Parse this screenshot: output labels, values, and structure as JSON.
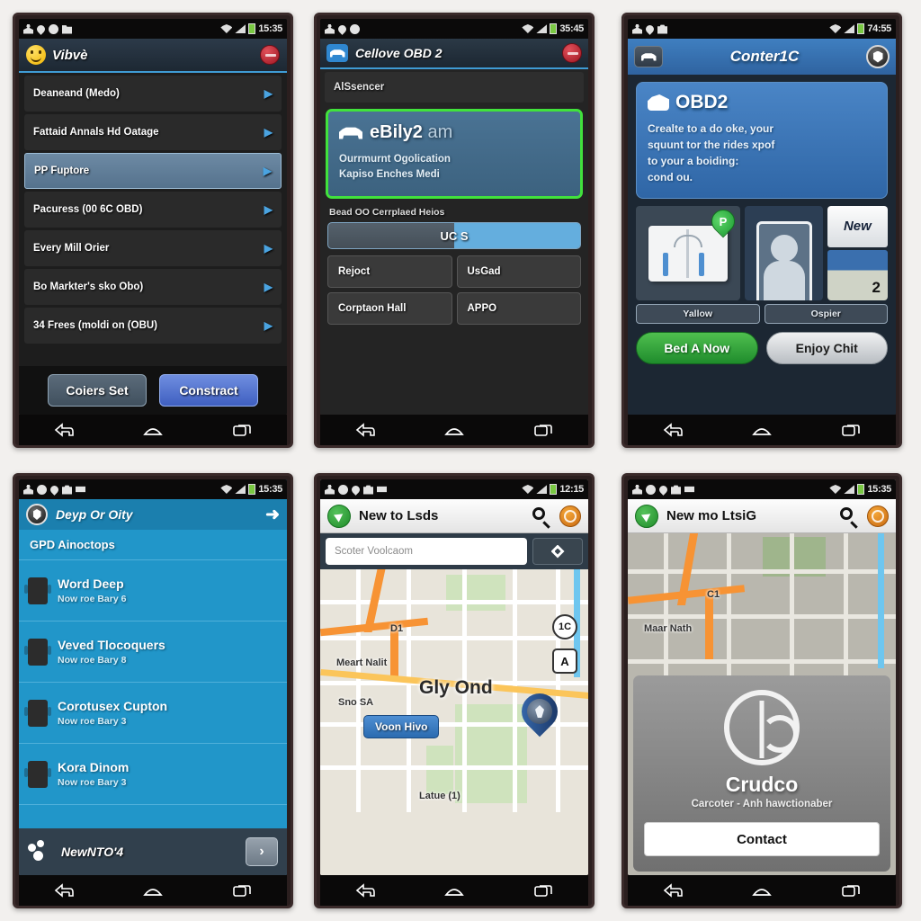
{
  "screens": [
    {
      "id": "vehicle-settings",
      "status": {
        "time": "15:35",
        "icons": [
          "person-icon",
          "pin-icon",
          "clock-icon",
          "folder-icon"
        ],
        "right_icons": [
          "wifi-icon",
          "signal-icon",
          "battery-icon"
        ]
      },
      "title": "Vibvè",
      "close_label": "close",
      "rows": [
        {
          "label": "Deaneand (Medo)",
          "selected": false
        },
        {
          "label": "Fattaid Annals Hd Oatage",
          "selected": false
        },
        {
          "label": "PP Fuptore",
          "selected": true
        },
        {
          "label": "Pacuress (00 6C OBD)",
          "selected": false
        },
        {
          "label": "Every Mill Orier",
          "selected": false
        },
        {
          "label": "Bo Markter's sko Obo)",
          "selected": false
        },
        {
          "label": "34 Frees (moldi on (OBU)",
          "selected": false
        }
      ],
      "buttons": {
        "secondary": "Coiers Set",
        "primary": "Constract"
      }
    },
    {
      "id": "obd-pair",
      "status": {
        "time": "35:45",
        "icons": [
          "person-icon",
          "pin-icon",
          "clock-icon"
        ],
        "right_icons": [
          "wifi-icon",
          "signal-icon",
          "battery-icon"
        ]
      },
      "title": "Cellove OBD 2",
      "subtitle": "AlSsencer",
      "card": {
        "title": "eBily2",
        "title_dim": "am",
        "line1": "Ourrmurnt Ogolication",
        "line2": "Kapiso Enches Medi"
      },
      "slider_label": "Bead OO Cerrplaed Heios",
      "slider_value": "UC S",
      "slider_fill_pct": 50,
      "grid_buttons": [
        "Rejoct",
        "UsGad",
        "Corptaon Hall",
        "APPO"
      ]
    },
    {
      "id": "obd-promo",
      "status": {
        "time": "74:55",
        "icons": [
          "person-icon",
          "pin-icon",
          "lock-icon"
        ],
        "right_icons": [
          "wifi-icon",
          "signal-icon",
          "battery-icon"
        ]
      },
      "title": "Conter1C",
      "hero": {
        "title": "OBD2",
        "lines": [
          "Crealte to a do oke, your",
          "squunt tor the rides xpof",
          "to your a boiding:",
          "cond ou."
        ]
      },
      "tiles": {
        "new_badge": "New",
        "map_badge": "2",
        "pin_letter": "P"
      },
      "tile_labels": [
        "Yallow",
        "Ospier"
      ],
      "cta": {
        "primary": "Bed A Now",
        "secondary": "Enjoy Chit"
      }
    },
    {
      "id": "device-list",
      "status": {
        "time": "15:35",
        "icons": [
          "person-icon",
          "clock-icon",
          "pin-icon",
          "camera-icon",
          "mail-icon"
        ],
        "right_icons": [
          "wifi-icon",
          "signal-icon",
          "battery-icon"
        ]
      },
      "title": "Deyp Or Oity",
      "section": "GPD Ainoctops",
      "items": [
        {
          "name": "Word Deep",
          "sub": "Now roe Bary 6"
        },
        {
          "name": "Veved Tlocoquers",
          "sub": "Now roe Bary 8"
        },
        {
          "name": "Corotusex Cupton",
          "sub": "Now roe Bary 3"
        },
        {
          "name": "Kora Dinom",
          "sub": "Now roe Bary 3"
        }
      ],
      "footer": {
        "label": "NewNTO'4",
        "button": "›"
      }
    },
    {
      "id": "map-search",
      "status": {
        "time": "12:15",
        "icons": [
          "person-icon",
          "clock-icon",
          "pin-icon",
          "camera-icon",
          "mail-icon"
        ],
        "right_icons": [
          "wifi-icon",
          "signal-icon",
          "battery-icon"
        ]
      },
      "title": "New to Lsds",
      "search_placeholder": "Scoter Voolcaom",
      "map_labels": {
        "street1": "Meart Nalit",
        "street2": "Sno SA",
        "big": "Gly Ond",
        "bottom": "Latue (1)",
        "node": "D1"
      },
      "map_chip": "Voon Hivo",
      "map_marks": {
        "round": "1C",
        "square": "A"
      }
    },
    {
      "id": "map-contact",
      "status": {
        "time": "15:35",
        "icons": [
          "person-icon",
          "clock-icon",
          "pin-icon",
          "camera-icon",
          "mail-icon"
        ],
        "right_icons": [
          "wifi-icon",
          "signal-icon",
          "battery-icon"
        ]
      },
      "title": "New mo LtsiG",
      "map_labels": {
        "street1": "Maar Nath",
        "node": "C1"
      },
      "card": {
        "name": "Crudco",
        "tagline": "Carcoter - Anh hawctionaber",
        "contact_button": "Contact"
      }
    }
  ],
  "navbar": {
    "back": "back-icon",
    "home": "home-icon",
    "recent": "recents-icon"
  },
  "colors": {
    "accent_blue": "#3f9bd4",
    "green": "#41e23c",
    "blue_header": "#2f63a0",
    "list_blue": "#2196c9"
  }
}
